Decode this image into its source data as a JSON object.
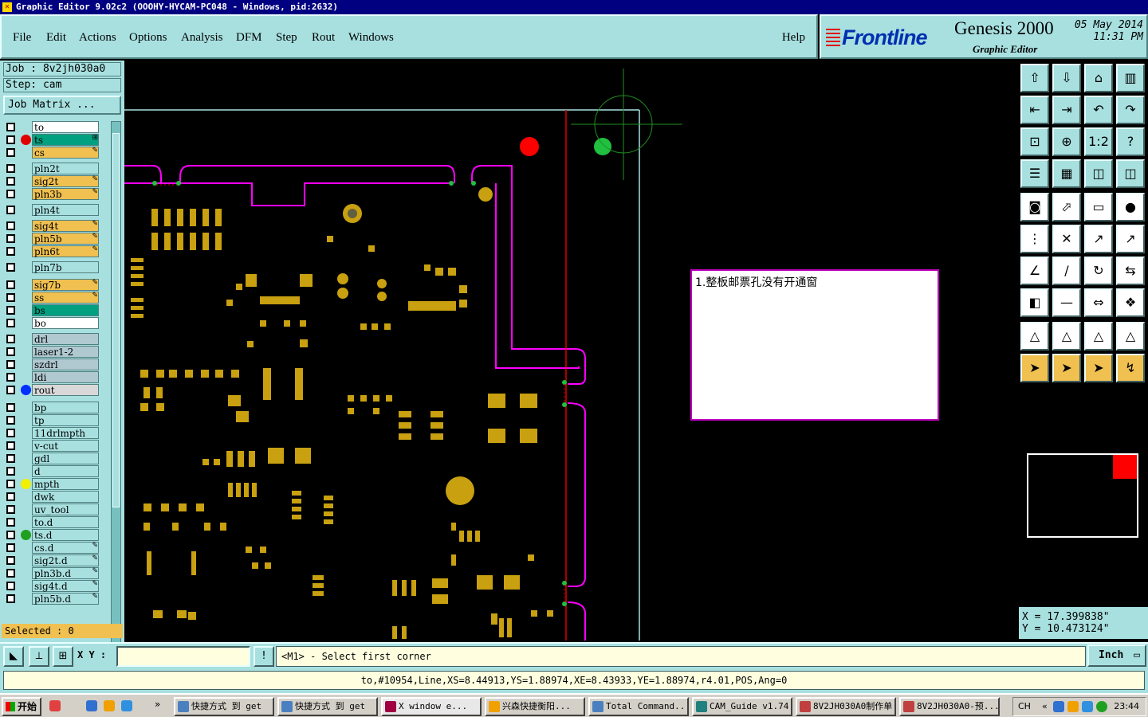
{
  "window": {
    "title": "Graphic Editor 9.02c2 (OOOHY-HYCAM-PC048 - Windows, pid:2632)"
  },
  "menu": {
    "items": [
      "File",
      "Edit",
      "Actions",
      "Options",
      "Analysis",
      "DFM",
      "Step",
      "Rout",
      "Windows"
    ],
    "help": "Help"
  },
  "brand": {
    "logo": "Frontline",
    "product": "Genesis 2000",
    "subtitle": "Graphic Editor",
    "date": "05 May 2014",
    "time": "11:31 PM"
  },
  "job": {
    "job": "Job : 8v2jh030a0",
    "step": "Step: cam",
    "matrix_button": "Job Matrix ..."
  },
  "layers": [
    {
      "name": "to",
      "color": "#ffffff",
      "dot": ""
    },
    {
      "name": "ts",
      "color": "#00a080",
      "dot": "#e00000",
      "marker": "⊞"
    },
    {
      "name": "cs",
      "color": "#f0c050",
      "dot": "",
      "marker": "✎"
    },
    {
      "name": "pln2t",
      "color": "#a8e0e0",
      "dot": ""
    },
    {
      "name": "sig2t",
      "color": "#f0c050",
      "dot": "",
      "marker": "✎"
    },
    {
      "name": "pln3b",
      "color": "#f0c050",
      "dot": "",
      "marker": "✎"
    },
    {
      "name": "pln4t",
      "color": "#a8e0e0",
      "dot": ""
    },
    {
      "name": "sig4t",
      "color": "#f0c050",
      "dot": "",
      "marker": "✎"
    },
    {
      "name": "pln5b",
      "color": "#f0c050",
      "dot": "",
      "marker": "✎"
    },
    {
      "name": "pln6t",
      "color": "#f0c050",
      "dot": "",
      "marker": "✎"
    },
    {
      "name": "pln7b",
      "color": "#a8e0e0",
      "dot": ""
    },
    {
      "name": "sig7b",
      "color": "#f0c050",
      "dot": "",
      "marker": "✎"
    },
    {
      "name": "ss",
      "color": "#f0c050",
      "dot": "",
      "marker": "✎"
    },
    {
      "name": "bs",
      "color": "#00a080",
      "dot": ""
    },
    {
      "name": "bo",
      "color": "#ffffff",
      "dot": ""
    },
    {
      "name": "drl",
      "color": "#b0c8d0",
      "dot": ""
    },
    {
      "name": "laser1-2",
      "color": "#b0c8d0",
      "dot": ""
    },
    {
      "name": "szdrl",
      "color": "#b0c8d0",
      "dot": ""
    },
    {
      "name": "ldi",
      "color": "#b0c8d0",
      "dot": ""
    },
    {
      "name": "rout",
      "color": "#d8d8d8",
      "dot": "#0030ff"
    },
    {
      "name": "bp",
      "color": "#a8e0e0",
      "dot": ""
    },
    {
      "name": "tp",
      "color": "#a8e0e0",
      "dot": ""
    },
    {
      "name": "11drlmpth",
      "color": "#a8e0e0",
      "dot": ""
    },
    {
      "name": "v-cut",
      "color": "#a8e0e0",
      "dot": ""
    },
    {
      "name": "gdl",
      "color": "#a8e0e0",
      "dot": ""
    },
    {
      "name": "d",
      "color": "#a8e0e0",
      "dot": ""
    },
    {
      "name": "mpth",
      "color": "#a8e0e0",
      "dot": "#f0f000"
    },
    {
      "name": "dwk",
      "color": "#a8e0e0",
      "dot": ""
    },
    {
      "name": "uv_tool",
      "color": "#a8e0e0",
      "dot": ""
    },
    {
      "name": "to.d",
      "color": "#a8e0e0",
      "dot": ""
    },
    {
      "name": "ts.d",
      "color": "#a8e0e0",
      "dot": "#20a020"
    },
    {
      "name": "cs.d",
      "color": "#a8e0e0",
      "dot": "",
      "marker": "✎"
    },
    {
      "name": "sig2t.d",
      "color": "#a8e0e0",
      "dot": "",
      "marker": "✎"
    },
    {
      "name": "pln3b.d",
      "color": "#a8e0e0",
      "dot": "",
      "marker": "✎"
    },
    {
      "name": "sig4t.d",
      "color": "#a8e0e0",
      "dot": "",
      "marker": "✎"
    },
    {
      "name": "pln5b.d",
      "color": "#a8e0e0",
      "dot": "",
      "marker": "✎"
    }
  ],
  "selected": "Selected : 0",
  "note": {
    "text": "1.整板邮票孔没有开通窗"
  },
  "coords": {
    "x": "X = 17.399838\"",
    "y": "Y = 10.473124\""
  },
  "command": {
    "xy_label": "X Y :",
    "input_value": "",
    "prompt": "<M1> - Select first corner",
    "units": "Inch"
  },
  "status": {
    "text": "to,#10954,Line,XS=8.44913,YS=1.88974,XE=8.43933,YE=1.88974,r4.01,POS,Ang=0"
  },
  "taskbar": {
    "start": "开始",
    "tasks": [
      "快捷方式 到 get",
      "快捷方式 到 get",
      "X window e...",
      "兴森快捷衡阳...",
      "Total Command...",
      "CAM_Guide v1.74",
      "8V2JH030A0制作单",
      "8V2JH030A0-预..."
    ],
    "lang": "CH",
    "clock": "23:44"
  },
  "colors": {
    "panel": "#a8e0e0",
    "copper": "#c8a010",
    "rout": "#ff00ff",
    "profile": "#e00000"
  }
}
